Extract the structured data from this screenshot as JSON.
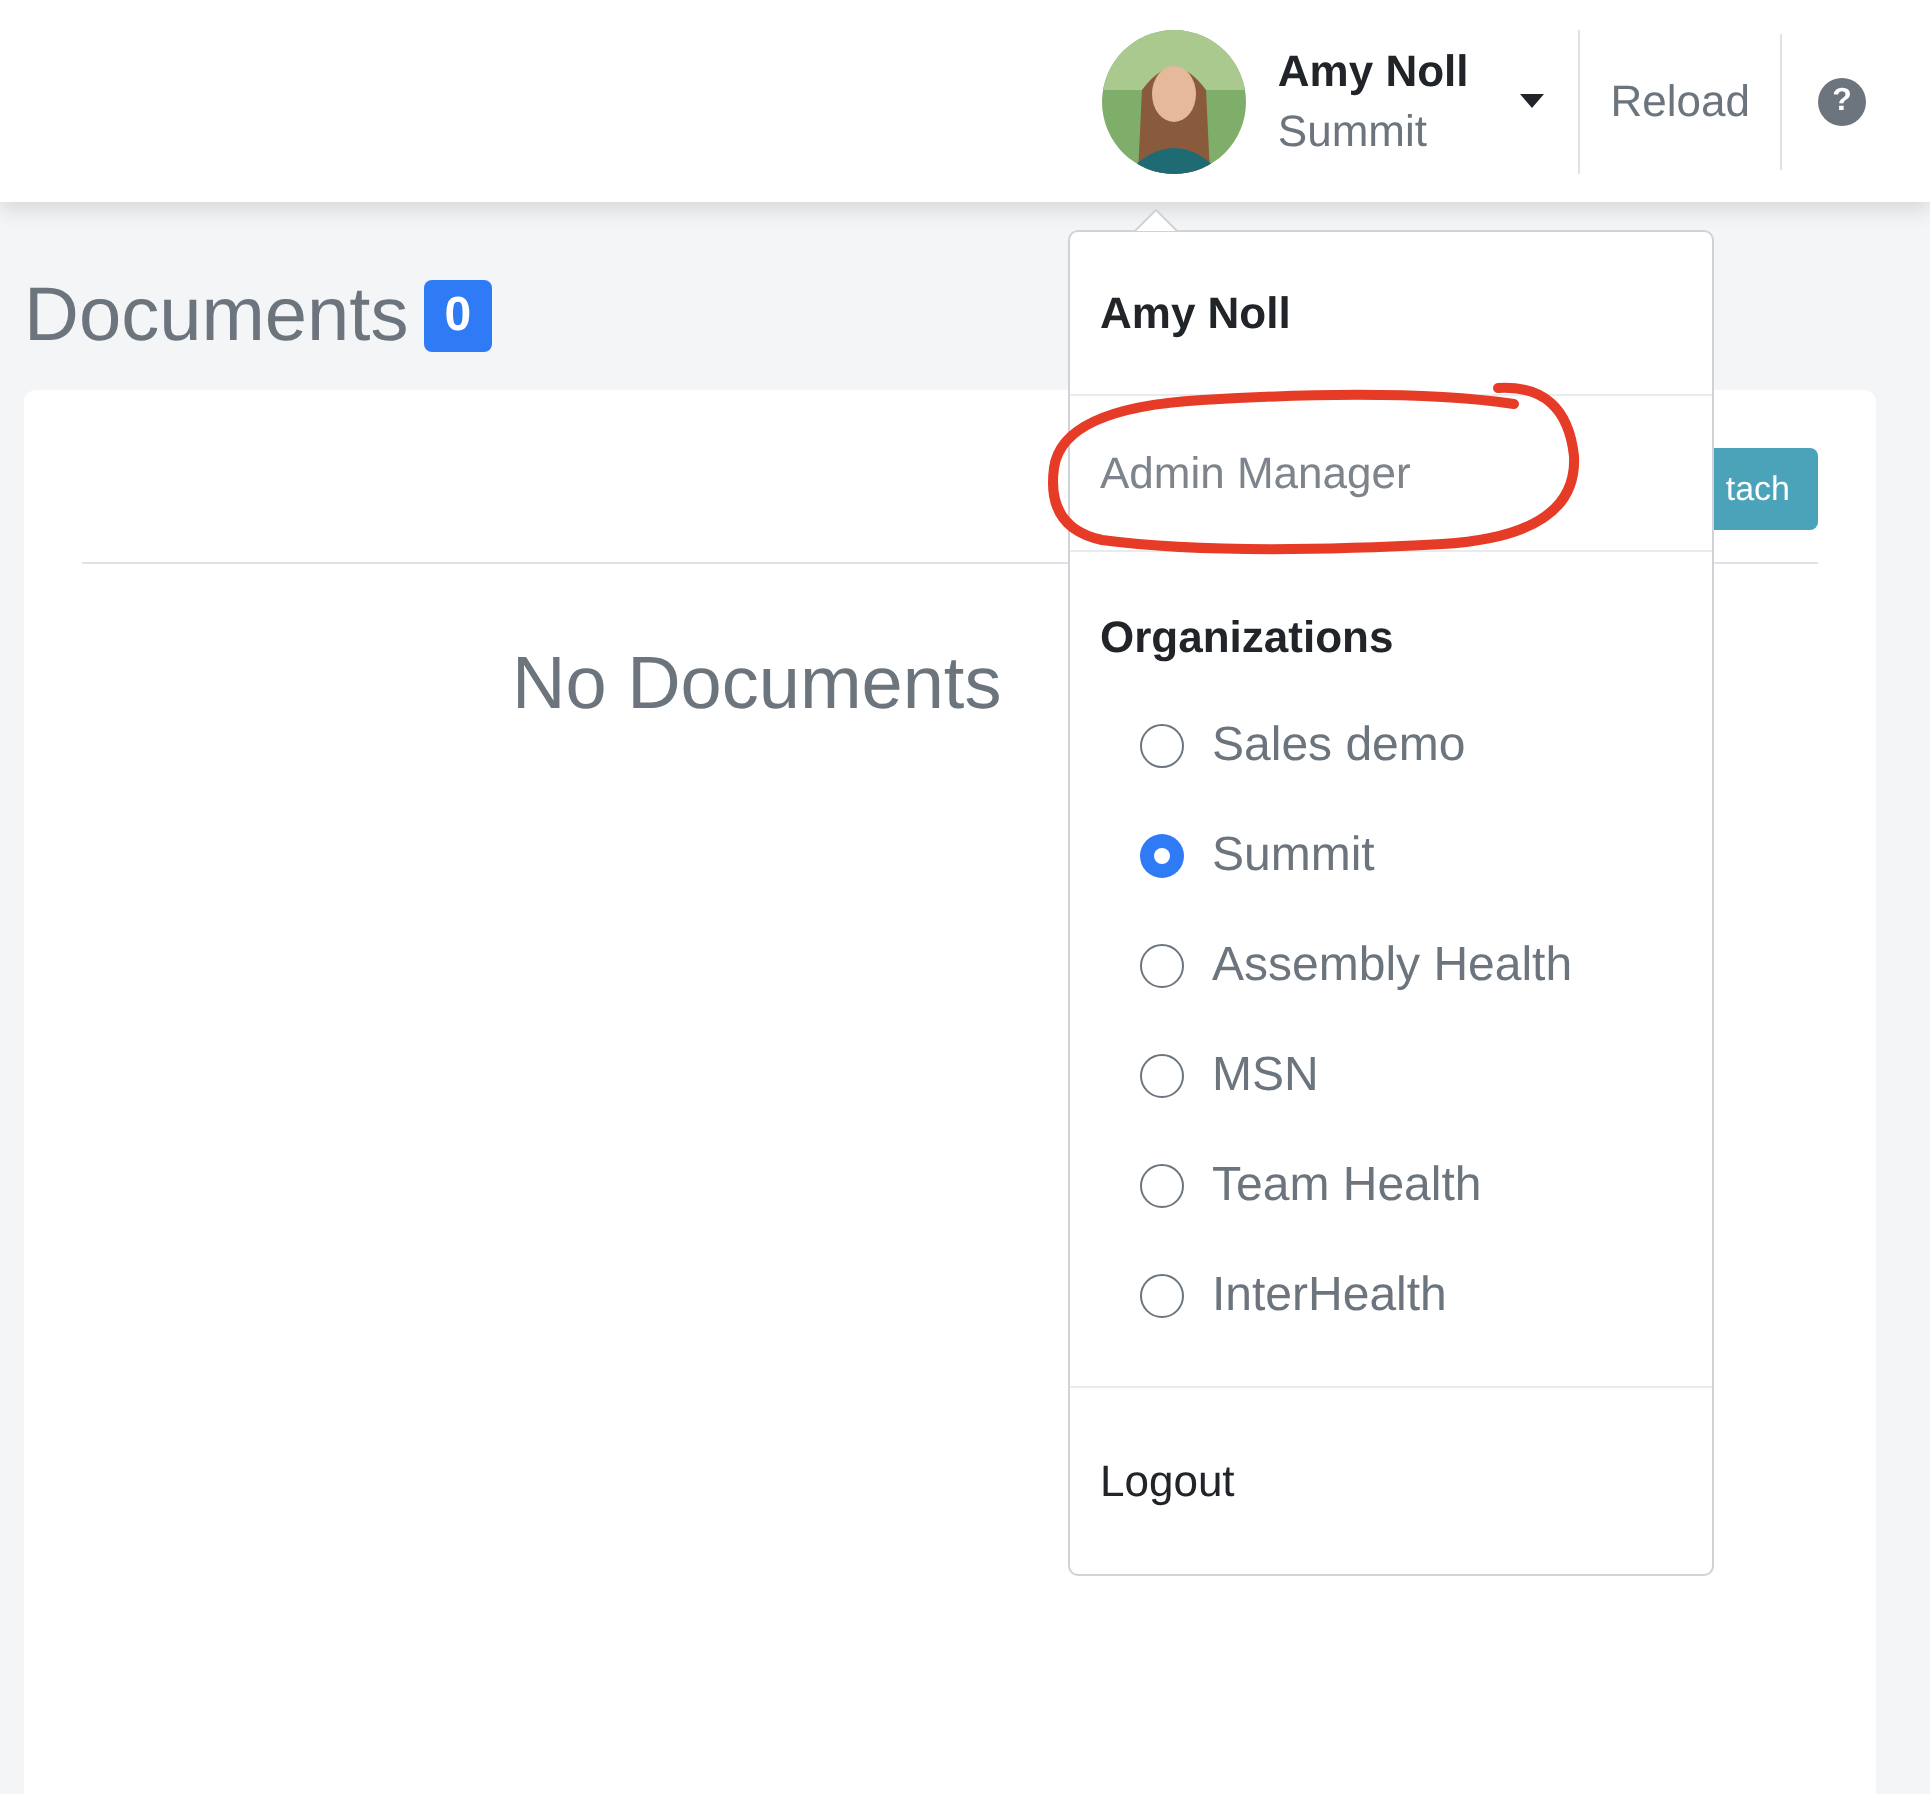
{
  "header": {
    "user_name": "Amy Noll",
    "user_org": "Summit",
    "reload": "Reload",
    "help": "?"
  },
  "page": {
    "title": "Documents",
    "count": "0",
    "attach_button": "tach",
    "empty_message": "No Documents"
  },
  "dropdown": {
    "name": "Amy Noll",
    "role": "Admin Manager",
    "role_annotated": true,
    "organizations_label": "Organizations",
    "organizations": [
      {
        "label": "Sales demo",
        "selected": false
      },
      {
        "label": "Summit",
        "selected": true
      },
      {
        "label": "Assembly Health",
        "selected": false
      },
      {
        "label": "MSN",
        "selected": false
      },
      {
        "label": "Team Health",
        "selected": false
      },
      {
        "label": "InterHealth",
        "selected": false
      }
    ],
    "logout": "Logout"
  }
}
